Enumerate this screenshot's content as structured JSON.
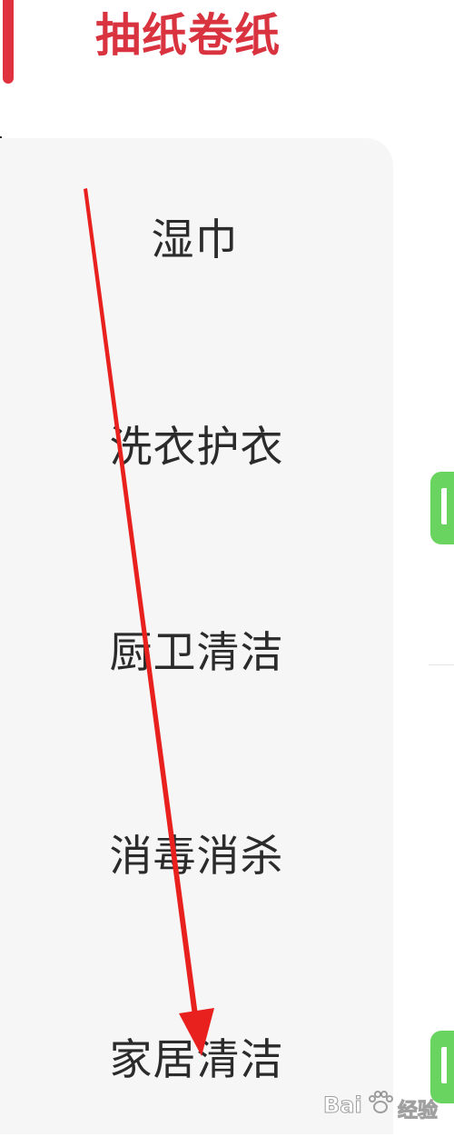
{
  "sidebar": {
    "active_item": {
      "label": "抽纸卷纸"
    },
    "items": [
      {
        "label": "湿巾"
      },
      {
        "label": "洗衣护衣"
      },
      {
        "label": "厨卫清洁"
      },
      {
        "label": "消毒消杀"
      },
      {
        "label": "家居清洁"
      }
    ]
  },
  "colors": {
    "accent": "#d8333f",
    "panel_background": "#f6f6f6",
    "item_text": "#2b2b2b",
    "tag_green": "#69d45f",
    "annotation_arrow": "#e8201e"
  },
  "watermark": {
    "text": "Bai",
    "suffix": "经验"
  }
}
